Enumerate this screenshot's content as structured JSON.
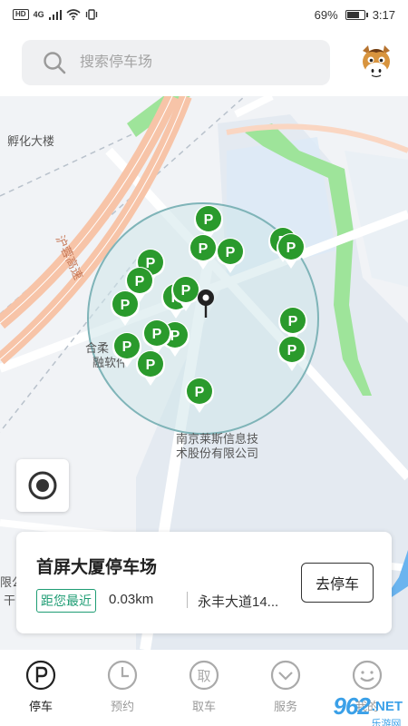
{
  "status_bar": {
    "network": "HD",
    "signal_gen": "4G",
    "battery_percent": "69%",
    "time": "3:17"
  },
  "search": {
    "placeholder": "搜索停车场"
  },
  "map": {
    "labels": {
      "incubator": "孵化大楼",
      "expressway": "沪蓉高速",
      "company_line1": "南京莱斯信息技",
      "company_line2": "术股份有限公司",
      "hehe_line1": "合柔",
      "hehe_line2": "融软件",
      "edge_left1": "限公",
      "edge_left2": "干"
    },
    "parking_icon": "parking-marker-icon"
  },
  "parking_card": {
    "name": "首屏大厦停车场",
    "tag": "距您最近",
    "distance": "0.03km",
    "address": "永丰大道14...",
    "action": "去停车"
  },
  "tabs": [
    {
      "label": "停车",
      "icon": "parking-p-icon",
      "active": true
    },
    {
      "label": "预约",
      "icon": "clock-icon",
      "active": false
    },
    {
      "label": "取车",
      "icon": "pickup-icon",
      "active": false
    },
    {
      "label": "服务",
      "icon": "chevron-down-circle-icon",
      "active": false
    },
    {
      "label": "我的",
      "icon": "smiley-icon",
      "active": false
    }
  ],
  "pickup_glyph": "取",
  "watermark": {
    "brand": "962",
    "domain": ".NET",
    "subtitle": "乐游网"
  },
  "colors": {
    "parking_green": "#2a9a2c",
    "accent_teal": "#1f9d74",
    "road_orange": "#f6bfa0",
    "park_green": "#9ee49a"
  }
}
